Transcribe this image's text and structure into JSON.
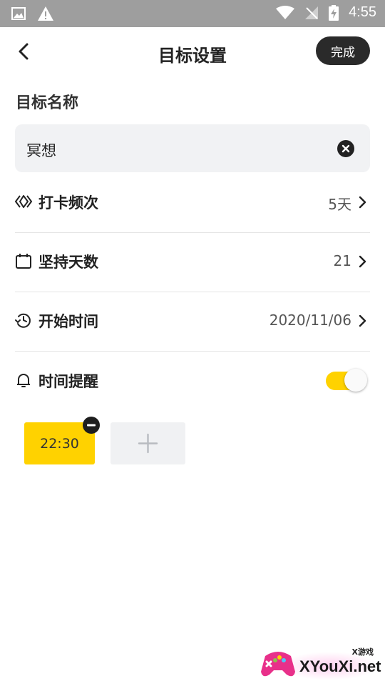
{
  "status_bar": {
    "time": "4:55"
  },
  "header": {
    "title": "目标设置",
    "done_label": "完成"
  },
  "goal_name": {
    "label": "目标名称",
    "value": "冥想"
  },
  "rows": [
    {
      "label": "打卡频次",
      "value": "5天",
      "icon": "frequency-icon"
    },
    {
      "label": "坚持天数",
      "value": "21",
      "icon": "calendar-icon"
    },
    {
      "label": "开始时间",
      "value": "2020/11/06",
      "icon": "clock-icon"
    }
  ],
  "reminder": {
    "label": "时间提醒",
    "enabled": true
  },
  "reminder_times": [
    "22:30"
  ],
  "colors": {
    "accent": "#ffd200",
    "dark": "#2a2a2a",
    "field_bg": "#f1f2f4"
  },
  "watermark": {
    "brand": "XYouXi.net",
    "tag": "X游戏"
  }
}
